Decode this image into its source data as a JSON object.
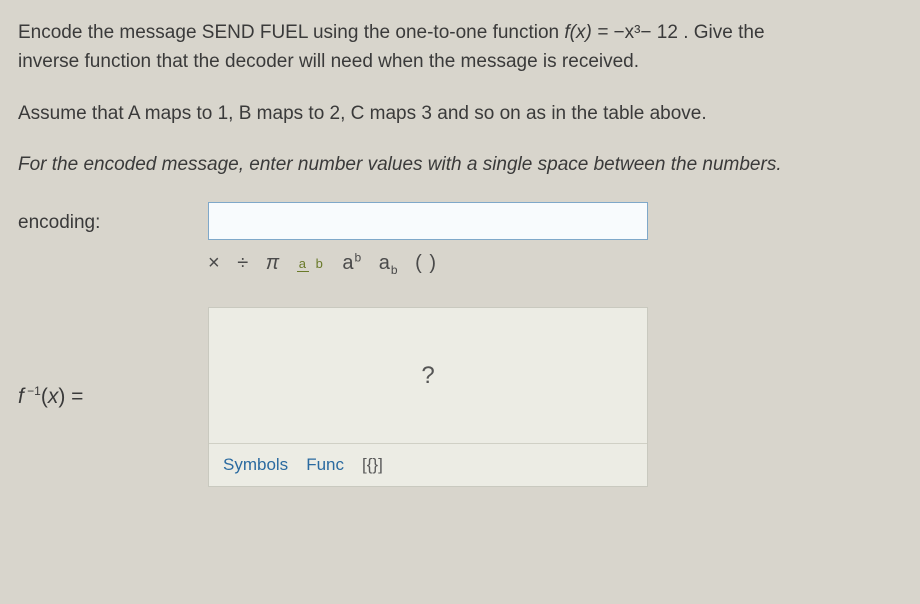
{
  "problem": {
    "line1_a": "Encode the message SEND FUEL using the one-to-one function ",
    "func_expr_lhs": "f(x) =",
    "func_expr_rhs": " −x³− 12",
    "line1_b": " . Give the",
    "line2": "inverse function that the decoder will need when the message is received.",
    "assume": "Assume that A maps to 1, B maps to 2, C maps 3 and so on as in the table above.",
    "instruct": "For the encoded message, enter number values with a single space between the numbers."
  },
  "fields": {
    "encoding_label": "encoding:",
    "encoding_value": "",
    "finv_label_html": "f⁻¹(x) =",
    "finv_placeholder": "?"
  },
  "symbol_row": {
    "times": "×",
    "divide": "÷",
    "pi": "π",
    "frac_a": "a",
    "frac_b": "b",
    "sup": "aᵇ",
    "sub": "aᵦ",
    "paren": "( )"
  },
  "tabs": {
    "symbols": "Symbols",
    "func": "Func",
    "sets": "[{}]"
  }
}
